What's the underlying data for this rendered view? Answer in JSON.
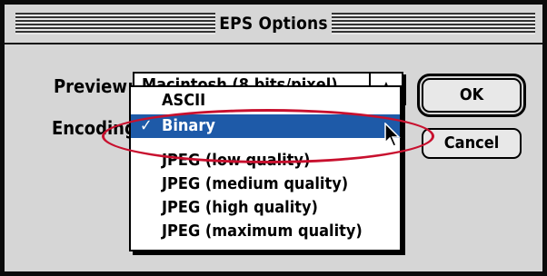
{
  "dialog": {
    "title": "EPS Options"
  },
  "labels": {
    "preview": "Preview:",
    "encoding": "Encoding:"
  },
  "preview_popup": {
    "selected": "Macintosh (8 bits/pixel)"
  },
  "encoding_menu": {
    "items": [
      {
        "label": "ASCII",
        "selected": false
      },
      {
        "label": "Binary",
        "selected": true
      },
      {
        "label": "JPEG (low quality)",
        "selected": false
      },
      {
        "label": "JPEG (medium quality)",
        "selected": false
      },
      {
        "label": "JPEG (high quality)",
        "selected": false
      },
      {
        "label": "JPEG (maximum quality)",
        "selected": false
      }
    ],
    "check_mark": "✓"
  },
  "buttons": {
    "ok": "OK",
    "cancel": "Cancel"
  },
  "colors": {
    "highlight": "#1e5aa8",
    "annotation": "#c8102e"
  }
}
